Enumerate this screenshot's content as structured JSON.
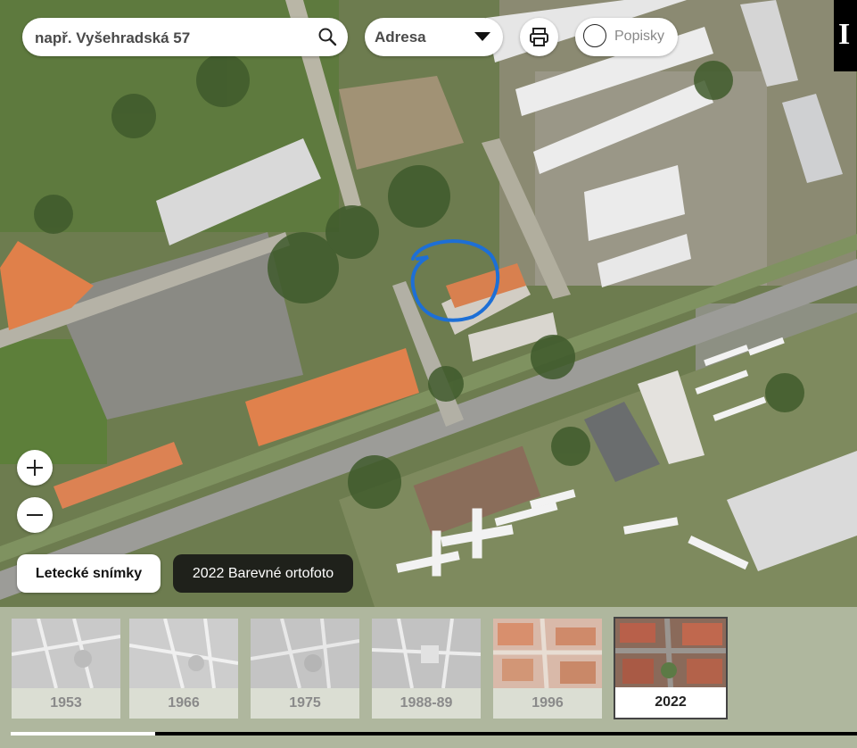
{
  "search": {
    "placeholder": "např. Vyšehradská 57"
  },
  "search_type": {
    "selected": "Adresa"
  },
  "labels_toggle": {
    "label": "Popisky",
    "checked": false
  },
  "info_button": {
    "label": "I"
  },
  "layer": {
    "button_label": "Letecké snímky",
    "caption": "2022 Barevné ortofoto"
  },
  "timeline": {
    "years": [
      {
        "label": "1953",
        "active": false
      },
      {
        "label": "1966",
        "active": false
      },
      {
        "label": "1975",
        "active": false
      },
      {
        "label": "1988-89",
        "active": false
      },
      {
        "label": "1996",
        "active": false
      },
      {
        "label": "2022",
        "active": true
      }
    ]
  },
  "colors": {
    "annotation": "#1d6fd6",
    "roof_orange": "#e0804a",
    "dark_bar": "#000000"
  },
  "icons": [
    "search-icon",
    "chevron-down-icon",
    "printer-icon",
    "plus-icon",
    "minus-icon"
  ]
}
